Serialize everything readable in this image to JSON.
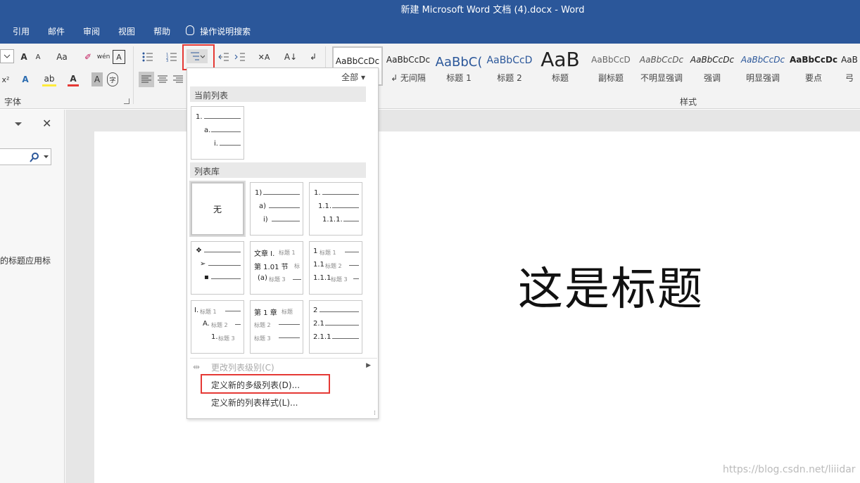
{
  "window": {
    "title": "新建 Microsoft Word 文档 (4).docx  -  Word"
  },
  "menu": {
    "items": [
      "引用",
      "邮件",
      "审阅",
      "视图",
      "帮助"
    ],
    "tell_me": "操作说明搜索"
  },
  "ribbon": {
    "font_group_label": "字体",
    "styles_group_label": "样式",
    "styles": [
      {
        "preview": "AaBbCcDc",
        "name": ""
      },
      {
        "preview": "AaBbCcDc",
        "name": "↲ 无间隔"
      },
      {
        "preview": "AaBbC(",
        "name": "标题 1"
      },
      {
        "preview": "AaBbCcD",
        "name": "标题 2"
      },
      {
        "preview": "AaB",
        "name": "标题"
      },
      {
        "preview": "AaBbCcD",
        "name": "副标题"
      },
      {
        "preview": "AaBbCcDc",
        "name": "不明显强调"
      },
      {
        "preview": "AaBbCcDc",
        "name": "强调"
      },
      {
        "preview": "AaBbCcDc",
        "name": "明显强调"
      },
      {
        "preview": "AaBbCcDc",
        "name": "要点"
      },
      {
        "preview": "AaB",
        "name": "弓"
      }
    ],
    "small_labels": {
      "font_size_up": "A",
      "font_size_down": "A",
      "change_case": "Aa",
      "sort": "A↓",
      "superscript": "x²"
    }
  },
  "nav_pane": {
    "partial_text": "的标题应用标"
  },
  "document": {
    "heading": "这是标题"
  },
  "multilevel_dropdown": {
    "filter": "全部",
    "current_list_header": "当前列表",
    "library_header": "列表库",
    "none_label": "无",
    "current": {
      "l1": "1.",
      "l2": "a.",
      "l3": "i."
    },
    "tile_b": {
      "l1": "1)",
      "l2": "a)",
      "l3": "i)"
    },
    "tile_c": {
      "l1": "1.",
      "l2": "1.1.",
      "l3": "1.1.1."
    },
    "tile_e": {
      "l1a": "文章 I.",
      "l1b": "标题 1",
      "l2a": "第 1.01 节",
      "l2b": "标",
      "l3a": "(a)",
      "l3b": "标题 3"
    },
    "tile_f": {
      "l1a": "1",
      "l1b": "标题 1",
      "l2a": "1.1",
      "l2b": "标题 2",
      "l3a": "1.1.1",
      "l3b": "标题 3"
    },
    "tile_g": {
      "l1a": "I.",
      "l1b": "标题 1",
      "l2a": "A.",
      "l2b": "标题 2",
      "l3a": "1.",
      "l3b": "标题 3"
    },
    "tile_h": {
      "l1a": "第 1 章",
      "l1b": "标题",
      "l2b": "标题 2",
      "l3b": "标题 3"
    },
    "tile_i": {
      "l1": "2",
      "l2": "2.1",
      "l3": "2.1.1"
    },
    "change_level": "更改列表级别(C)",
    "define_new_multilevel": "定义新的多级列表(D)...",
    "define_new_style": "定义新的列表样式(L)..."
  },
  "watermark": "https://blog.csdn.net/liiidar",
  "colors": {
    "title_bar": "#2b579a",
    "highlight_box": "#e53935"
  }
}
